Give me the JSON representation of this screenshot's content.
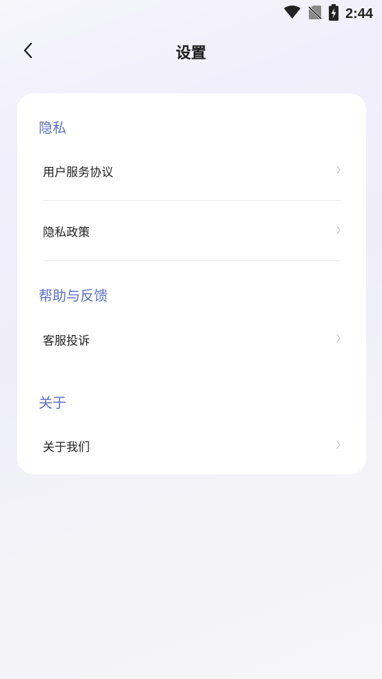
{
  "status_bar": {
    "time": "2:44",
    "icons": [
      "wifi-icon",
      "no-sim-icon",
      "battery-charging-icon"
    ]
  },
  "header": {
    "title": "设置",
    "back_icon": "chevron-left-icon"
  },
  "sections": [
    {
      "title": "隐私",
      "items": [
        {
          "label": "用户服务协议",
          "icon": "chevron-right-icon"
        },
        {
          "label": "隐私政策",
          "icon": "chevron-right-icon"
        }
      ]
    },
    {
      "title": "帮助与反馈",
      "items": [
        {
          "label": "客服投诉",
          "icon": "chevron-right-icon"
        }
      ]
    },
    {
      "title": "关于",
      "items": [
        {
          "label": "关于我们",
          "icon": "chevron-right-icon"
        }
      ]
    }
  ],
  "colors": {
    "section_title": "#5b72c4",
    "card_background": "#ffffff",
    "chevron": "#c4c4cc"
  }
}
